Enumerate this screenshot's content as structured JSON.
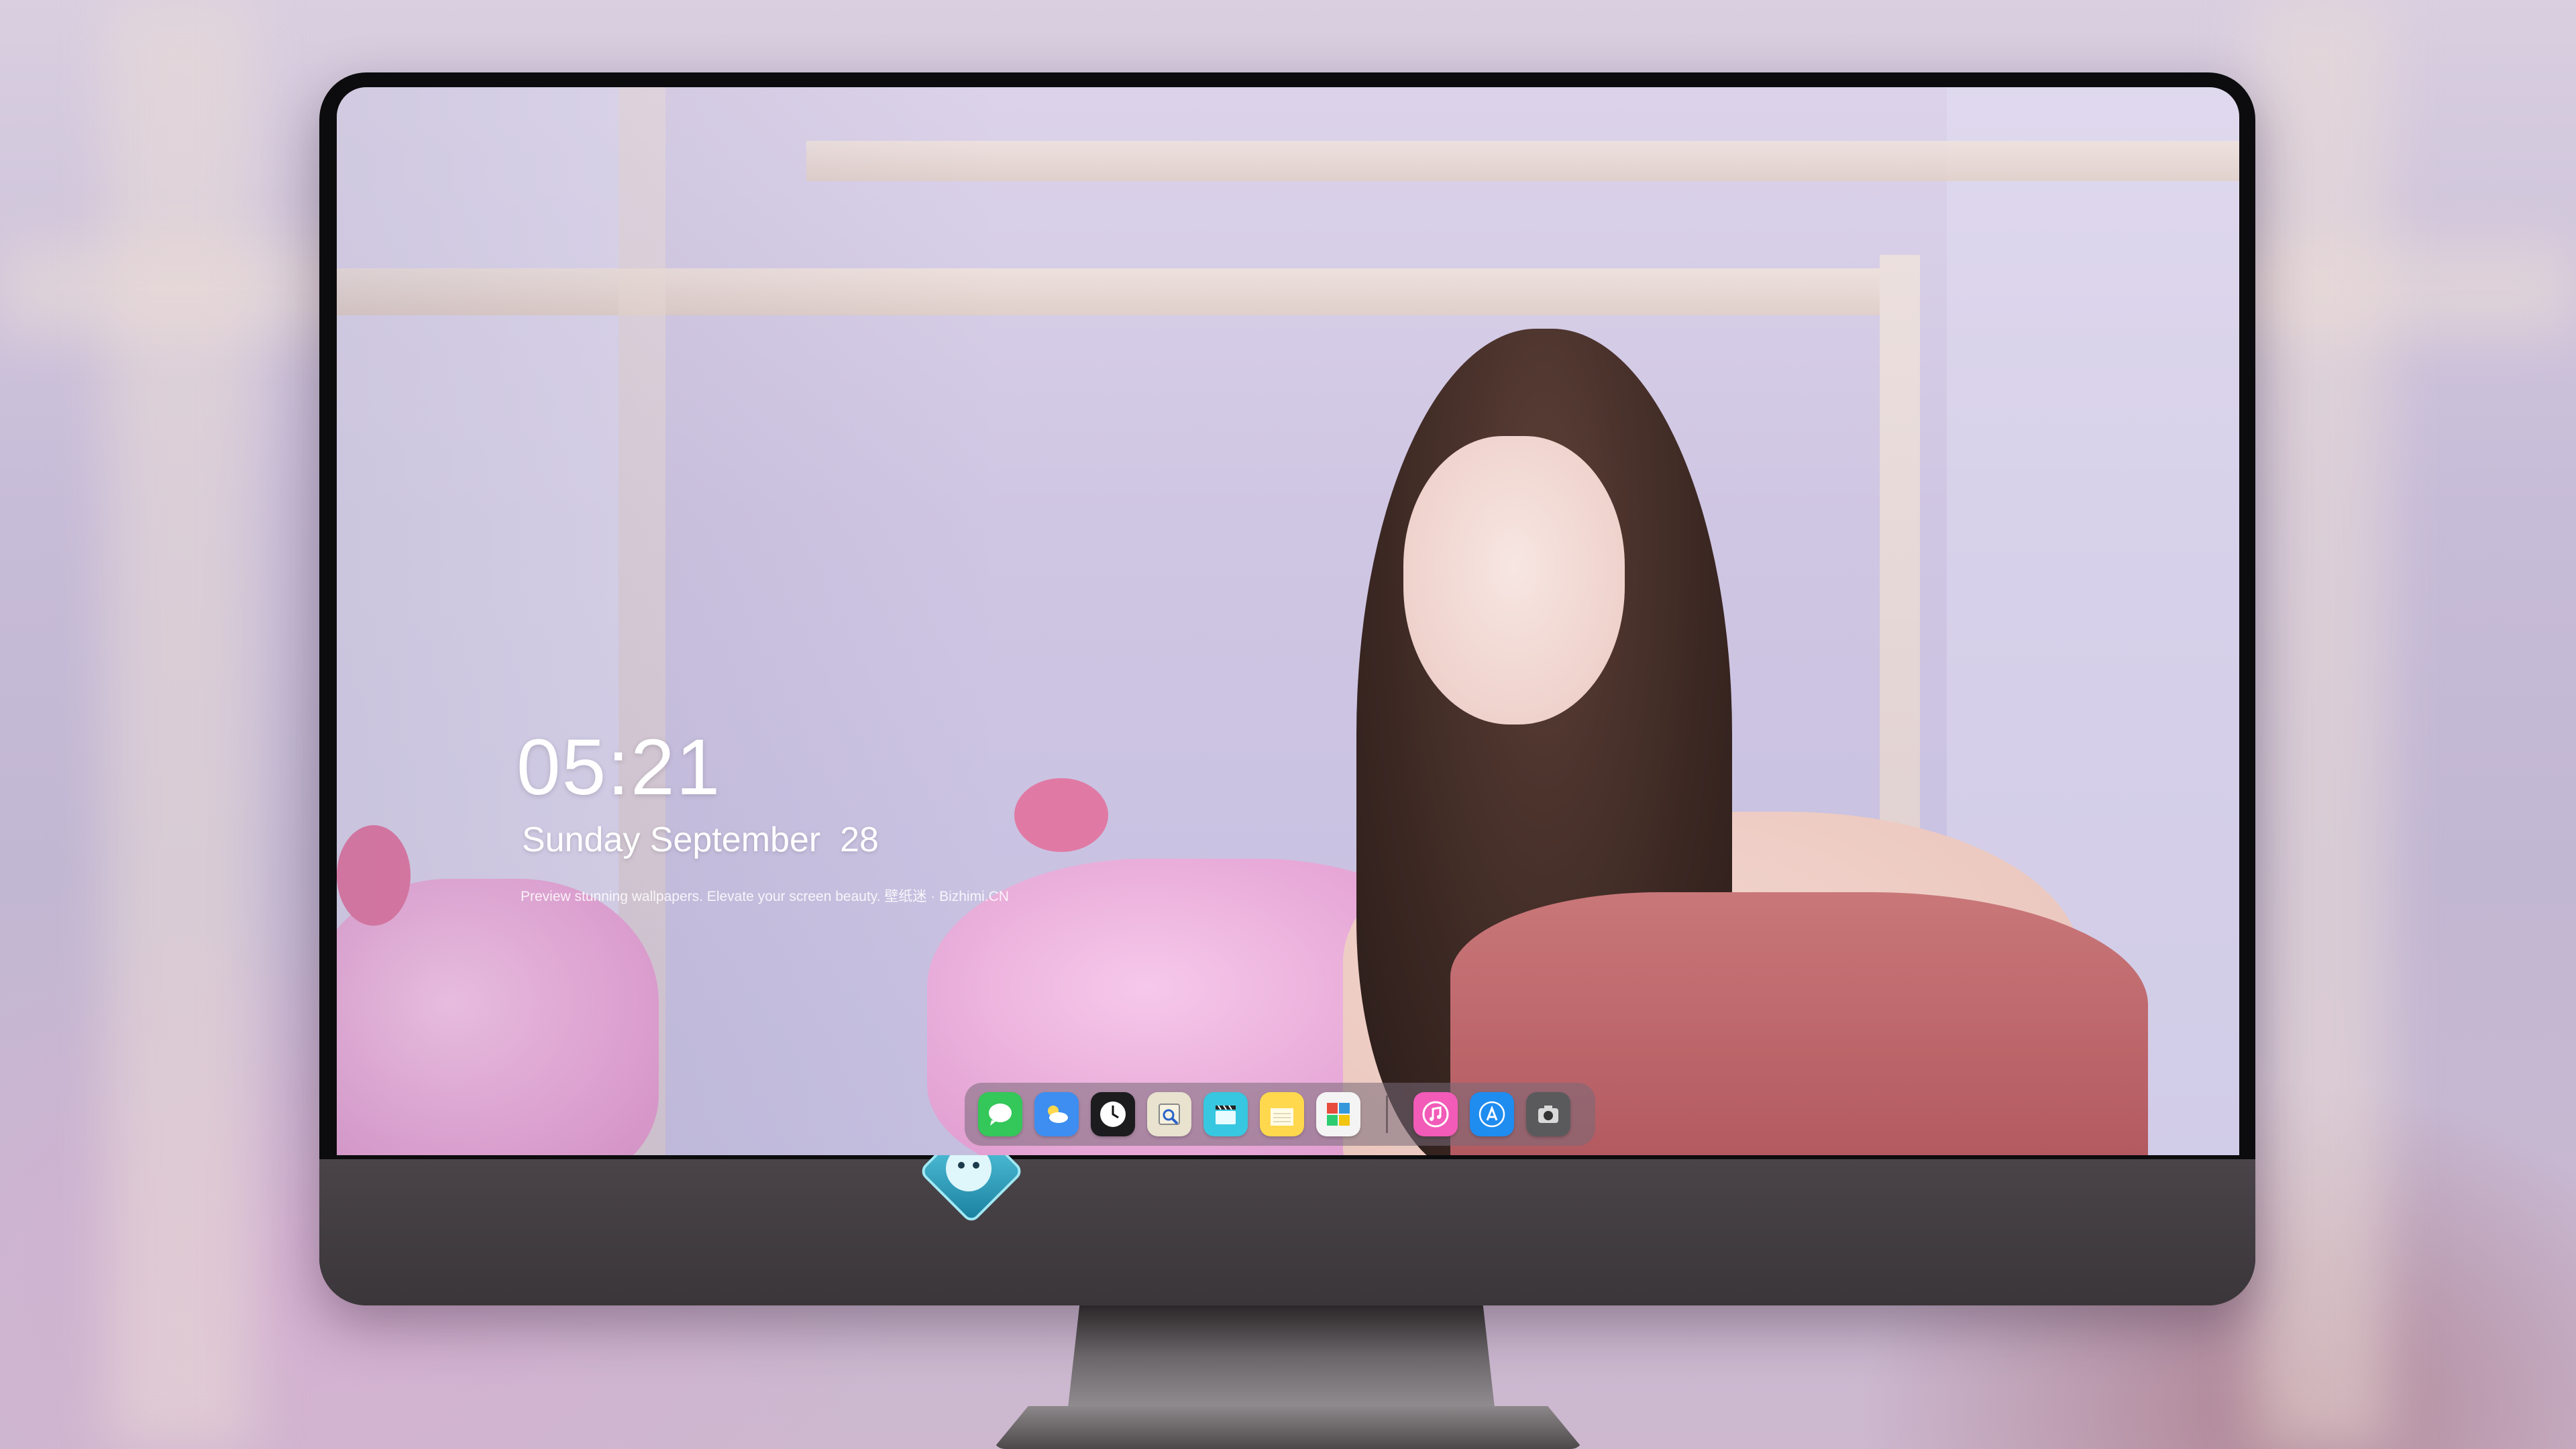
{
  "lockscreen": {
    "time": "05:21",
    "date": "Sunday September  28",
    "tagline": "Preview stunning wallpapers. Elevate your screen beauty. 壁纸迷 · Bizhimi.CN"
  },
  "dock": {
    "apps": [
      {
        "name": "Messages",
        "icon": "messages-icon",
        "color": "#34c759"
      },
      {
        "name": "Weather",
        "icon": "weather-icon",
        "color": "#3d8ef0"
      },
      {
        "name": "Clock",
        "icon": "clock-icon",
        "color": "#1c1c1e"
      },
      {
        "name": "Preview",
        "icon": "preview-icon",
        "color": "#e8e2cf"
      },
      {
        "name": "Clips",
        "icon": "clips-icon",
        "color": "#38c7e0"
      },
      {
        "name": "Notes",
        "icon": "notes-icon",
        "color": "#ffd84d"
      },
      {
        "name": "Photo Booth",
        "icon": "photos-collage-icon",
        "color": "#f4f4f4"
      },
      {
        "name": "Music",
        "icon": "music-icon",
        "color": "#f25bb8"
      },
      {
        "name": "App Store",
        "icon": "app-store-icon",
        "color": "#1f8cf0"
      },
      {
        "name": "Camera",
        "icon": "camera-icon",
        "color": "#5a5a5c"
      }
    ]
  },
  "monitor": {
    "logo": "dragon-mascot-logo"
  }
}
